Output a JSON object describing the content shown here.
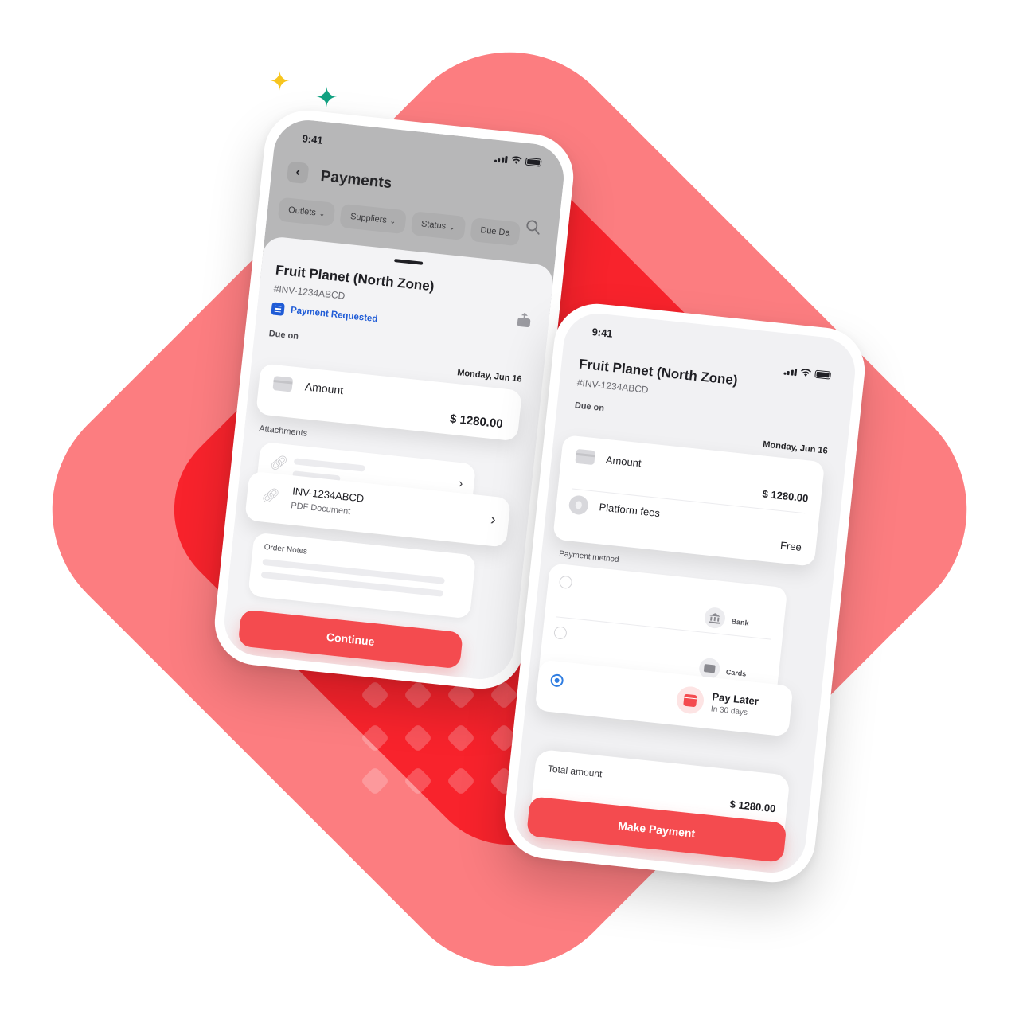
{
  "colors": {
    "accent": "#f44b4f",
    "bg_outer": "#fc7d80",
    "bg_inner": "#f8232c",
    "link_blue": "#1f5bd6",
    "radio_blue": "#2f7de1"
  },
  "left_phone": {
    "status_time": "9:41",
    "header": {
      "title": "Payments",
      "back_icon": "chevron-left-icon",
      "search_icon": "search-icon"
    },
    "filters": [
      "Outlets",
      "Suppliers",
      "Status",
      "Due Da"
    ],
    "sheet": {
      "title": "Fruit Planet (North Zone)",
      "invoice_id": "#INV-1234ABCD",
      "status": "Payment Requested",
      "due_label": "Due on",
      "due_date": "Monday, Jun 16",
      "amount_label": "Amount",
      "amount_value": "$ 1280.00",
      "attachments_label": "Attachments",
      "attachment_name": "INV-1234ABCD",
      "attachment_type": "PDF Document",
      "notes_label": "Order Notes",
      "continue_label": "Continue"
    }
  },
  "right_phone": {
    "status_time": "9:41",
    "title": "Fruit Planet (North Zone)",
    "invoice_id": "#INV-1234ABCD",
    "due_label": "Due on",
    "due_date": "Monday, Jun 16",
    "amount_label": "Amount",
    "amount_value": "$ 1280.00",
    "fees_label": "Platform fees",
    "fees_value": "Free",
    "payment_method_label": "Payment method",
    "methods": [
      {
        "label": "Bank",
        "icon": "bank-icon",
        "selected": false
      },
      {
        "label": "Cards",
        "icon": "card-icon",
        "selected": false
      },
      {
        "label": "Pay Later",
        "sub": "In 30 days",
        "icon": "calendar-icon",
        "selected": true
      }
    ],
    "total_label": "Total amount",
    "total_value": "$ 1280.00",
    "pay_button": "Make Payment"
  }
}
